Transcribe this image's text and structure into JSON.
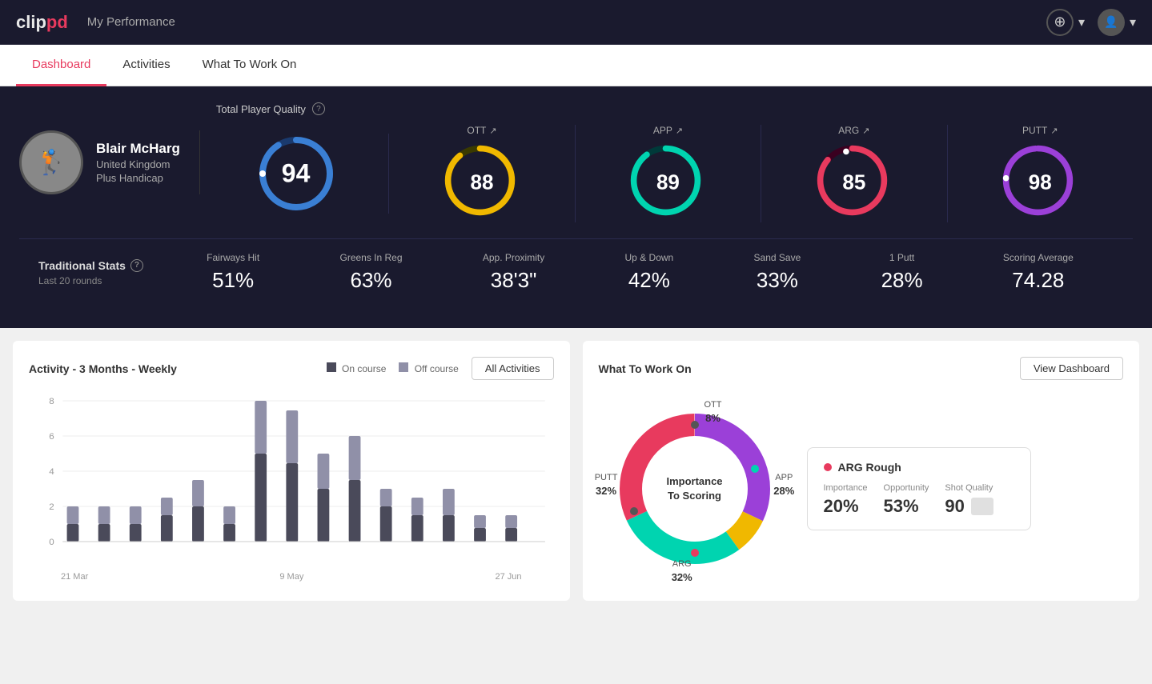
{
  "app": {
    "logo_clip": "clip",
    "logo_pd": "pd",
    "header_title": "My Performance",
    "add_icon": "+",
    "chevron_down": "▾",
    "help_icon": "?"
  },
  "tabs": [
    {
      "label": "Dashboard",
      "active": true
    },
    {
      "label": "Activities",
      "active": false
    },
    {
      "label": "What To Work On",
      "active": false
    }
  ],
  "player": {
    "name": "Blair McHarg",
    "country": "United Kingdom",
    "handicap": "Plus Handicap"
  },
  "quality": {
    "label": "Total Player Quality",
    "scores": [
      {
        "key": "total",
        "value": "94",
        "color_track": "#1a3a6e",
        "color_fill": "#3a7fd4",
        "large": true
      },
      {
        "key": "ott",
        "label": "OTT",
        "value": "88",
        "color_track": "#3a3a00",
        "color_fill": "#f0b800"
      },
      {
        "key": "app",
        "label": "APP",
        "value": "89",
        "color_track": "#003a3a",
        "color_fill": "#00d4b0"
      },
      {
        "key": "arg",
        "label": "ARG",
        "value": "85",
        "color_track": "#3a0020",
        "color_fill": "#e83a5e"
      },
      {
        "key": "putt",
        "label": "PUTT",
        "value": "98",
        "color_track": "#2a003a",
        "color_fill": "#9b40d8"
      }
    ]
  },
  "trad_stats": {
    "label": "Traditional Stats",
    "period": "Last 20 rounds",
    "items": [
      {
        "name": "Fairways Hit",
        "value": "51%"
      },
      {
        "name": "Greens In Reg",
        "value": "63%"
      },
      {
        "name": "App. Proximity",
        "value": "38'3\""
      },
      {
        "name": "Up & Down",
        "value": "42%"
      },
      {
        "name": "Sand Save",
        "value": "33%"
      },
      {
        "name": "1 Putt",
        "value": "28%"
      },
      {
        "name": "Scoring Average",
        "value": "74.28"
      }
    ]
  },
  "activity_chart": {
    "title": "Activity - 3 Months - Weekly",
    "legend": [
      {
        "label": "On course",
        "color": "#4a4a5a"
      },
      {
        "label": "Off course",
        "color": "#9090a8"
      }
    ],
    "all_activities_btn": "All Activities",
    "x_labels": [
      "21 Mar",
      "9 May",
      "27 Jun"
    ],
    "y_labels": [
      "0",
      "2",
      "4",
      "6",
      "8"
    ],
    "bars": [
      {
        "on": 1,
        "off": 1
      },
      {
        "on": 1,
        "off": 1
      },
      {
        "on": 1,
        "off": 1
      },
      {
        "on": 1.5,
        "off": 1
      },
      {
        "on": 2,
        "off": 1.5
      },
      {
        "on": 1,
        "off": 1
      },
      {
        "on": 5,
        "off": 4
      },
      {
        "on": 4.5,
        "off": 3.5
      },
      {
        "on": 3,
        "off": 2
      },
      {
        "on": 3.5,
        "off": 2.5
      },
      {
        "on": 2,
        "off": 1
      },
      {
        "on": 1.5,
        "off": 1
      },
      {
        "on": 1.5,
        "off": 1.5
      },
      {
        "on": 0.8,
        "off": 0.5
      },
      {
        "on": 0.8,
        "off": 0.5
      }
    ]
  },
  "what_to_work_on": {
    "title": "What To Work On",
    "view_dashboard_btn": "View Dashboard",
    "donut_center": "Importance\nTo Scoring",
    "segments": [
      {
        "label": "OTT",
        "pct": "8%",
        "color": "#f0b800",
        "position": {
          "top": "4%",
          "left": "52%"
        }
      },
      {
        "label": "APP",
        "pct": "28%",
        "color": "#00d4b0",
        "position": {
          "top": "42%",
          "right": "2%"
        }
      },
      {
        "label": "ARG",
        "pct": "32%",
        "color": "#e83a5e",
        "position": {
          "bottom": "2%",
          "left": "42%"
        }
      },
      {
        "label": "PUTT",
        "pct": "32%",
        "color": "#9b40d8",
        "position": {
          "top": "42%",
          "left": "2%"
        }
      }
    ],
    "info_card": {
      "title": "ARG Rough",
      "dot_color": "#e83a5e",
      "metrics": [
        {
          "label": "Importance",
          "value": "20%"
        },
        {
          "label": "Opportunity",
          "value": "53%"
        },
        {
          "label": "Shot Quality",
          "value": "90"
        }
      ]
    }
  }
}
